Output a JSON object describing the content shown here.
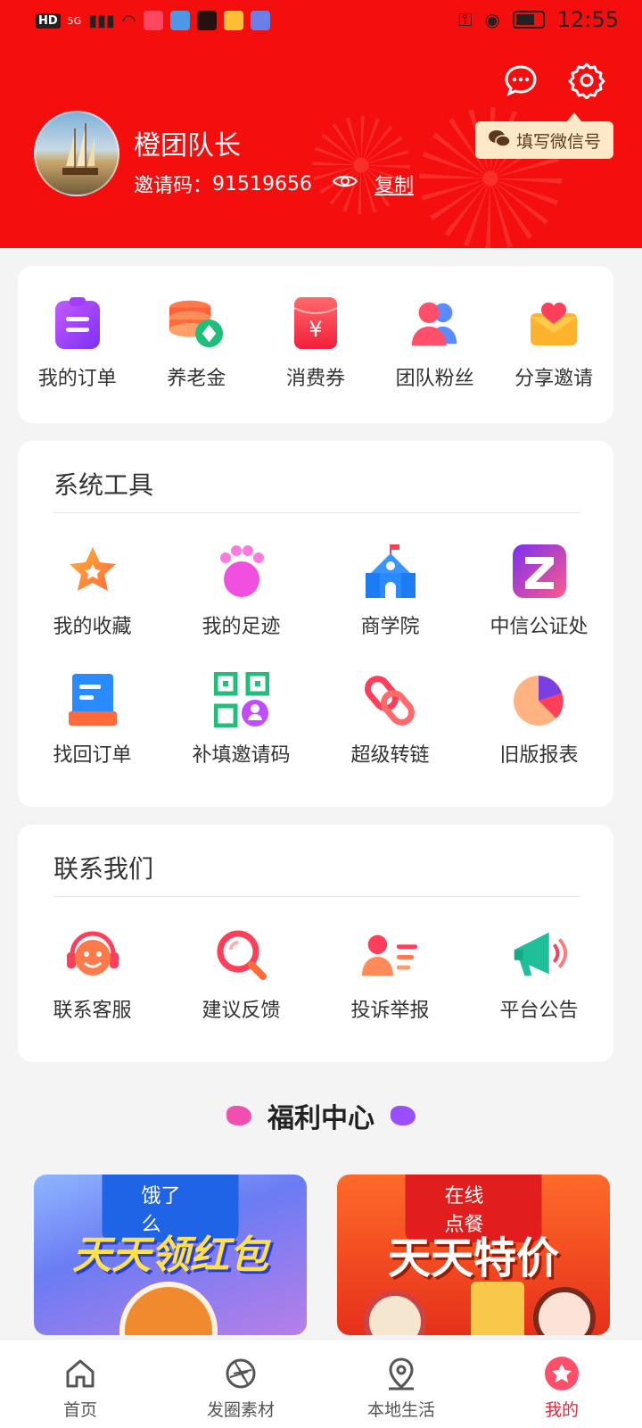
{
  "status_bar": {
    "left_badges": [
      "HD",
      "5G"
    ],
    "time": "12:55"
  },
  "header": {
    "username": "橙团队长",
    "invite_label": "邀请码：",
    "invite_code": "91519656",
    "copy_label": "复制",
    "wechat_tip": "填写微信号"
  },
  "quick_actions": [
    {
      "label": "我的订单",
      "icon": "clipboard-icon"
    },
    {
      "label": "养老金",
      "icon": "coin-stack-icon"
    },
    {
      "label": "消费券",
      "icon": "red-packet-icon"
    },
    {
      "label": "团队粉丝",
      "icon": "team-icon"
    },
    {
      "label": "分享邀请",
      "icon": "heart-envelope-icon"
    }
  ],
  "tools": {
    "title": "系统工具",
    "items": [
      {
        "label": "我的收藏",
        "icon": "star-icon"
      },
      {
        "label": "我的足迹",
        "icon": "paw-icon"
      },
      {
        "label": "商学院",
        "icon": "school-icon"
      },
      {
        "label": "中信公证处",
        "icon": "z-logo-icon"
      },
      {
        "label": "找回订单",
        "icon": "document-tray-icon"
      },
      {
        "label": "补填邀请码",
        "icon": "qr-code-icon"
      },
      {
        "label": "超级转链",
        "icon": "link-icon"
      },
      {
        "label": "旧版报表",
        "icon": "pie-chart-icon"
      }
    ]
  },
  "contact": {
    "title": "联系我们",
    "items": [
      {
        "label": "联系客服",
        "icon": "customer-service-icon"
      },
      {
        "label": "建议反馈",
        "icon": "search-feedback-icon"
      },
      {
        "label": "投诉举报",
        "icon": "user-list-icon"
      },
      {
        "label": "平台公告",
        "icon": "megaphone-icon"
      }
    ]
  },
  "welfare": {
    "title": "福利中心",
    "promos": [
      {
        "tag": "饿了么",
        "headline": "天天领红包"
      },
      {
        "tag": "在线点餐",
        "headline": "天天特价"
      }
    ]
  },
  "bottom_nav": {
    "items": [
      {
        "label": "首页",
        "icon": "home-icon"
      },
      {
        "label": "发圈素材",
        "icon": "aperture-icon"
      },
      {
        "label": "本地生活",
        "icon": "location-pin-icon"
      },
      {
        "label": "我的",
        "icon": "profile-star-icon"
      }
    ],
    "active_index": 3
  },
  "colors": {
    "header_red": "#f50e0e",
    "active_nav": "#e8283c",
    "wechat_tip_bg": "#fde8c8"
  }
}
